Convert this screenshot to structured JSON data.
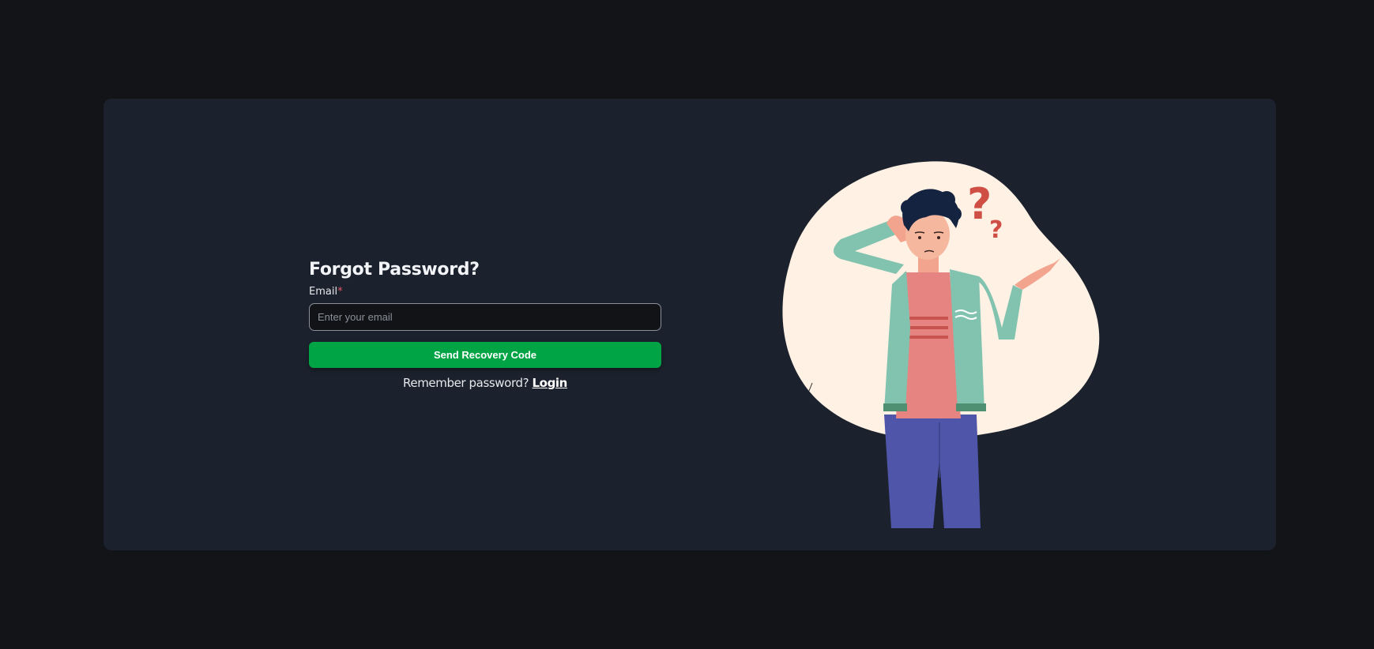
{
  "form": {
    "title": "Forgot Password?",
    "email_label": "Email",
    "required_mark": "*",
    "email_placeholder": "Enter your email",
    "email_value": "",
    "submit_label": "Send Recovery Code",
    "remember_text": "Remember password?",
    "login_link": "Login"
  },
  "colors": {
    "page_bg": "#131418",
    "card_bg": "#1c222d",
    "primary_button": "#00a444",
    "required": "#e0566a",
    "illustration_blob": "#fff1e3"
  },
  "illustration": {
    "icon": "confused-person-illustration"
  }
}
